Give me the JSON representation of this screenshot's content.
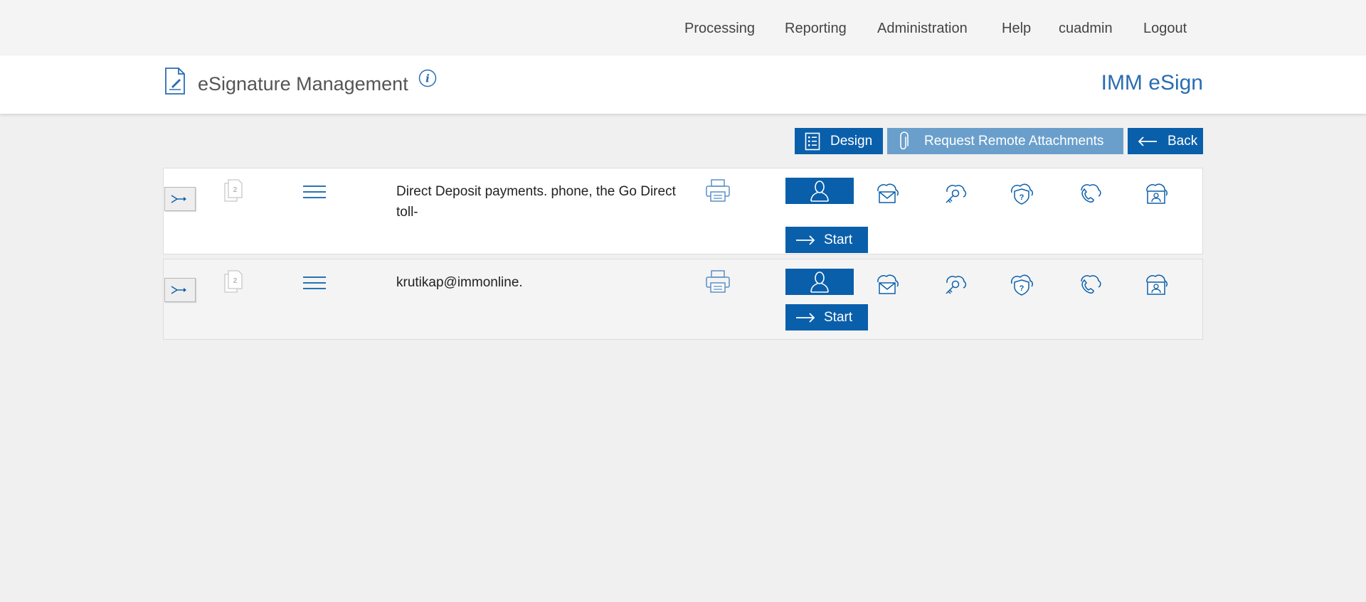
{
  "nav": {
    "items": [
      "Processing",
      "Reporting",
      "Administration",
      "Help",
      "cuadmin",
      "Logout"
    ]
  },
  "header": {
    "title": "eSignature Management",
    "brand": "IMM eSign"
  },
  "toolbar": {
    "design_label": "Design",
    "attachments_label": "Request Remote Attachments",
    "back_label": "Back"
  },
  "rows": [
    {
      "page_count": "2",
      "text": "Direct Deposit payments. phone, the Go Direct toll-",
      "start_label": "Start"
    },
    {
      "page_count": "2",
      "text": "krutikap@immonline.",
      "start_label": "Start"
    }
  ],
  "icons": {
    "expand": "arrow-route-icon",
    "pages": "document-pages-icon",
    "menu": "hamburger-menu-icon",
    "print": "printer-icon",
    "person": "person-icon",
    "channels": [
      "cloud-mail-icon",
      "key-icon",
      "shield-question-icon",
      "phone-icon",
      "id-card-icon"
    ]
  },
  "colors": {
    "primary": "#0a5fab",
    "primary_light": "#6a9fcc",
    "brand_text": "#2a6db1",
    "background": "#f0f0f0"
  }
}
